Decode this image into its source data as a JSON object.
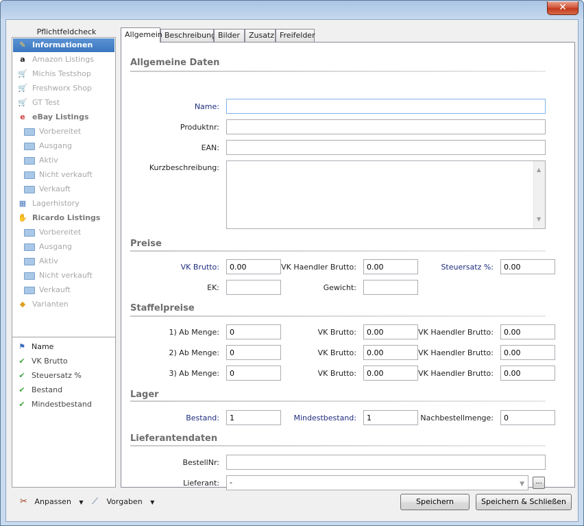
{
  "window": {
    "close_symbol": "✕"
  },
  "left_panel": {
    "header": "Pflichtfeldcheck",
    "tree": [
      {
        "label": "Informationen",
        "icon": "pencil-icon",
        "level": 0,
        "selected": true
      },
      {
        "label": "Amazon Listings",
        "icon": "amazon-icon",
        "level": 0
      },
      {
        "label": "Michis Testshop",
        "icon": "cart-icon",
        "level": 0
      },
      {
        "label": "Freshworx Shop",
        "icon": "cart-icon",
        "level": 0
      },
      {
        "label": "GT Test",
        "icon": "cart-icon",
        "level": 0
      },
      {
        "label": "eBay Listings",
        "icon": "ebay-icon",
        "level": 0,
        "bold": true
      },
      {
        "label": "Vorbereitet",
        "icon": "folder-icon",
        "level": 1
      },
      {
        "label": "Ausgang",
        "icon": "folder-icon",
        "level": 1
      },
      {
        "label": "Aktiv",
        "icon": "folder-icon",
        "level": 1
      },
      {
        "label": "Nicht verkauft",
        "icon": "folder-icon",
        "level": 1
      },
      {
        "label": "Verkauft",
        "icon": "folder-icon",
        "level": 1
      },
      {
        "label": "Lagerhistory",
        "icon": "table-icon",
        "level": 0
      },
      {
        "label": "Ricardo Listings",
        "icon": "hand-icon",
        "level": 0,
        "bold": true
      },
      {
        "label": "Vorbereitet",
        "icon": "folder-icon",
        "level": 1
      },
      {
        "label": "Ausgang",
        "icon": "folder-icon",
        "level": 1
      },
      {
        "label": "Aktiv",
        "icon": "folder-icon",
        "level": 1
      },
      {
        "label": "Nicht verkauft",
        "icon": "folder-icon",
        "level": 1
      },
      {
        "label": "Verkauft",
        "icon": "folder-icon",
        "level": 1
      },
      {
        "label": "Varianten",
        "icon": "tag-icon",
        "level": 0
      }
    ],
    "checklist": [
      {
        "label": "Name",
        "icon": "flag-icon"
      },
      {
        "label": "VK Brutto",
        "icon": "check-icon"
      },
      {
        "label": "Steuersatz %",
        "icon": "check-icon"
      },
      {
        "label": "Bestand",
        "icon": "check-icon"
      },
      {
        "label": "Mindestbestand",
        "icon": "check-icon"
      }
    ]
  },
  "tabs": [
    "Allgemein",
    "Beschreibung",
    "Bilder",
    "Zusatz",
    "Freifelder"
  ],
  "sections": {
    "allgemeine": "Allgemeine Daten",
    "preise": "Preise",
    "staffel": "Staffelpreise",
    "lager": "Lager",
    "lieferant": "Lieferantendaten"
  },
  "fields": {
    "name_label": "Name:",
    "name_value": "",
    "produktnr_label": "Produktnr:",
    "produktnr_value": "",
    "ean_label": "EAN:",
    "ean_value": "",
    "kurz_label": "Kurzbeschreibung:",
    "kurz_value": "",
    "vkbrutto_label": "VK Brutto:",
    "vkbrutto_value": "0.00",
    "vkhaendler_label": "VK Haendler Brutto:",
    "vkhaendler_value": "0.00",
    "steuer_label": "Steuersatz %:",
    "steuer_value": "0.00",
    "ek_label": "EK:",
    "ek_value": "",
    "gewicht_label": "Gewicht:",
    "gewicht_value": "",
    "bestand_label": "Bestand:",
    "bestand_value": "1",
    "mindest_label": "Mindestbestand:",
    "mindest_value": "1",
    "nachbestell_label": "Nachbestellmenge:",
    "nachbestell_value": "0",
    "bestellnr_label": "BestellNr:",
    "bestellnr_value": "",
    "lieferant_label": "Lieferant:",
    "lieferant_value": "-",
    "browse_label": "..."
  },
  "staffel": [
    {
      "menge_label": "1) Ab Menge:",
      "menge": "0",
      "vk_label": "VK Brutto:",
      "vk": "0.00",
      "h_label": "VK Haendler Brutto:",
      "h": "0.00"
    },
    {
      "menge_label": "2) Ab Menge:",
      "menge": "0",
      "vk_label": "VK Brutto:",
      "vk": "0.00",
      "h_label": "VK Haendler Brutto:",
      "h": "0.00"
    },
    {
      "menge_label": "3) Ab Menge:",
      "menge": "0",
      "vk_label": "VK Brutto:",
      "vk": "0.00",
      "h_label": "VK Haendler Brutto:",
      "h": "0.00"
    }
  ],
  "footer": {
    "anpassen": "Anpassen",
    "vorgaben": "Vorgaben",
    "speichern": "Speichern",
    "speichern_schliessen": "Speichern & Schließen"
  }
}
